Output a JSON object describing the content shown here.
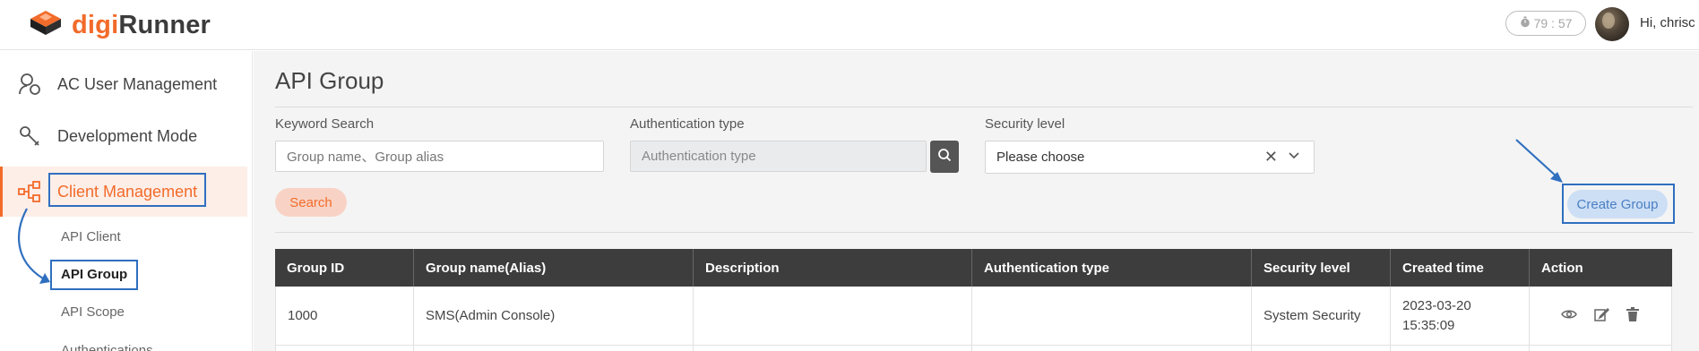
{
  "header": {
    "logo_digi": "digi",
    "logo_runner": "Runner",
    "timer": "79 : 57",
    "greeting": "Hi, chrisc"
  },
  "sidebar": {
    "items": [
      {
        "label": "AC User Management",
        "icon": "user-management-icon"
      },
      {
        "label": "Development Mode",
        "icon": "wrench-icon"
      },
      {
        "label": "Client Management",
        "icon": "client-tree-icon",
        "active": true
      }
    ],
    "subitems": [
      {
        "label": "API Client"
      },
      {
        "label": "API Group",
        "active": true
      },
      {
        "label": "API Scope"
      },
      {
        "label": "Authentications"
      }
    ]
  },
  "main": {
    "title": "API Group",
    "keyword": {
      "label": "Keyword Search",
      "placeholder": "Group name、Group alias"
    },
    "auth": {
      "label": "Authentication type",
      "placeholder": "Authentication type"
    },
    "security": {
      "label": "Security level",
      "value": "Please choose"
    },
    "search_button": "Search",
    "create_button": "Create Group"
  },
  "table": {
    "columns": [
      "Group ID",
      "Group name(Alias)",
      "Description",
      "Authentication type",
      "Security level",
      "Created time",
      "Action"
    ],
    "rows": [
      {
        "group_id": "1000",
        "group_name": "SMS(Admin Console)",
        "description": "",
        "auth_type": "",
        "security_level": "System Security",
        "created_date": "2023-03-20",
        "created_time": "15:35:09"
      }
    ]
  },
  "colors": {
    "brand": "#f26b2a",
    "highlight_box": "#2f6fbf",
    "table_header": "#3d3d3d"
  }
}
